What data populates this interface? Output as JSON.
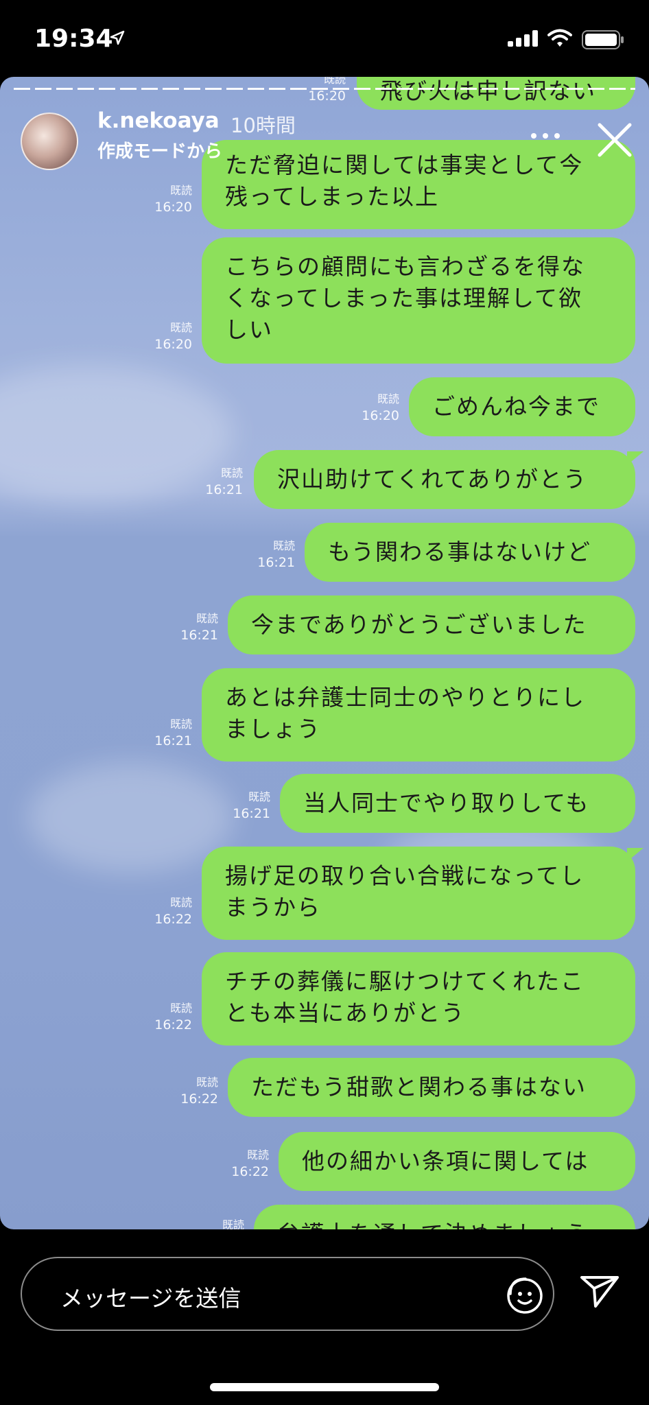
{
  "status_bar": {
    "time": "19:34"
  },
  "story": {
    "username": "k.nekoaya",
    "time_ago": "10時間",
    "subtitle": "作成モードから",
    "messages": [
      {
        "read": "既読",
        "time": "16:20",
        "text": "飛び火は申し訳ない"
      },
      {
        "read": "既読",
        "time": "16:20",
        "text": "ただ脅迫に関しては事実として今\n残ってしまった以上"
      },
      {
        "read": "既読",
        "time": "16:20",
        "text": "こちらの顧問にも言わざるを得な\nくなってしまった事は理解して欲\nしい"
      },
      {
        "read": "既読",
        "time": "16:20",
        "text": "ごめんね今まで"
      },
      {
        "read": "既読",
        "time": "16:21",
        "text": "沢山助けてくれてありがとう"
      },
      {
        "read": "既読",
        "time": "16:21",
        "text": "もう関わる事はないけど"
      },
      {
        "read": "既読",
        "time": "16:21",
        "text": "今までありがとうございました"
      },
      {
        "read": "既読",
        "time": "16:21",
        "text": "あとは弁護士同士のやりとりにし\nましょう"
      },
      {
        "read": "既読",
        "time": "16:21",
        "text": "当人同士でやり取りしても"
      },
      {
        "read": "既読",
        "time": "16:22",
        "text": "揚げ足の取り合い合戦になってし\nまうから"
      },
      {
        "read": "既読",
        "time": "16:22",
        "text": "チチの葬儀に駆けつけてくれたこ\nとも本当にありがとう"
      },
      {
        "read": "既読",
        "time": "16:22",
        "text": "ただもう甜歌と関わる事はない"
      },
      {
        "read": "既読",
        "time": "16:22",
        "text": "他の細かい条項に関しては"
      },
      {
        "read": "既読",
        "time": "",
        "text": "弁護士を通して決めましょう"
      }
    ]
  },
  "reply": {
    "placeholder": "メッセージを送信"
  },
  "icons": {
    "location": "location-arrow-icon",
    "signal": "signal-icon",
    "wifi": "wifi-icon",
    "battery": "battery-icon",
    "more": "more-icon",
    "close": "close-icon",
    "sticker": "sticker-icon",
    "send": "send-icon"
  },
  "colors": {
    "bubble": "#8de05b",
    "background": "#000000",
    "story_sky": "#8ea4d2"
  }
}
